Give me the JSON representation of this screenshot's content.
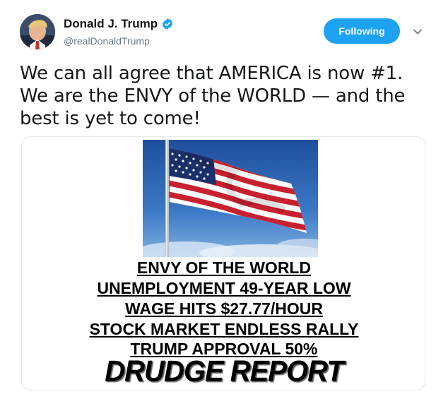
{
  "user": {
    "display_name": "Donald J. Trump",
    "handle": "@realDonaldTrump",
    "verified": true,
    "avatar_icon": "profile-photo"
  },
  "follow_button": {
    "label": "Following"
  },
  "menu_icon": "chevron-down-icon",
  "tweet": {
    "text": "We can all agree that AMERICA is now #1. We are the ENVY of the WORLD — and the best is yet to come!"
  },
  "media": {
    "image_icon": "american-flag",
    "headlines": [
      "ENVY OF THE WORLD",
      "UNEMPLOYMENT 49-YEAR LOW",
      "WAGE HITS $27.77/HOUR",
      "STOCK MARKET ENDLESS RALLY",
      "TRUMP APPROVAL 50%"
    ],
    "brand": "DRUDGE REPORT"
  },
  "colors": {
    "accent": "#1da1f2",
    "text": "#14171a",
    "muted": "#657786",
    "border": "#e1e8ed"
  }
}
